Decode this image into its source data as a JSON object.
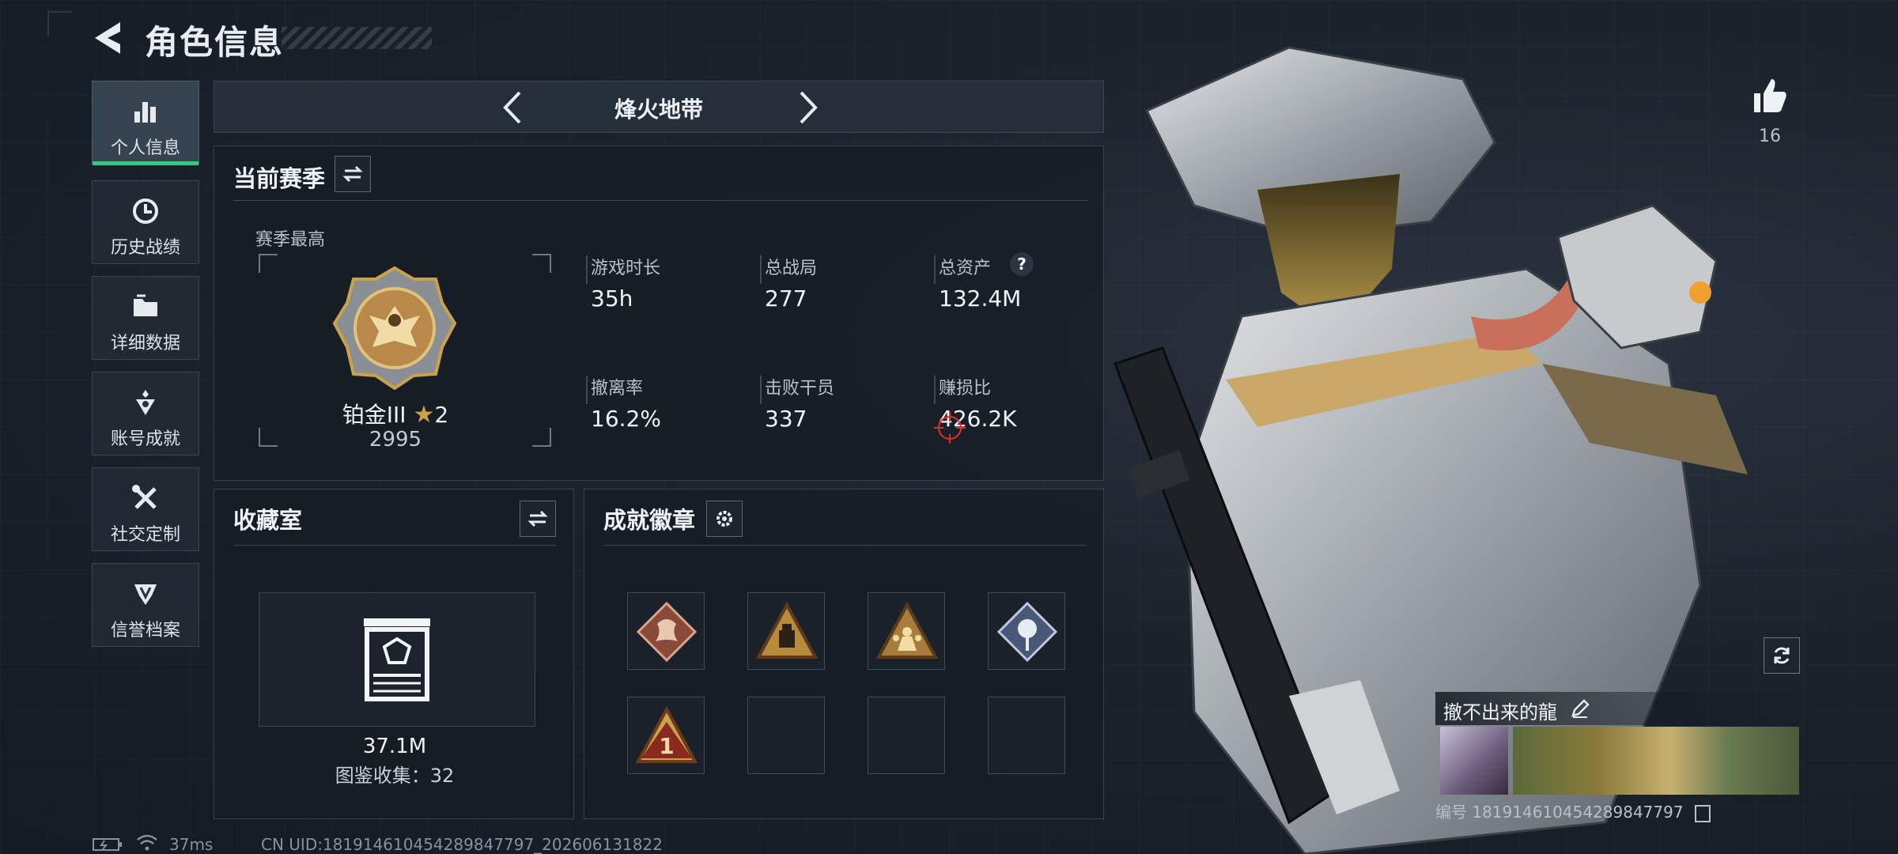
{
  "header": {
    "title": "角色信息",
    "back_icon": "back-arrow-icon"
  },
  "sidebar": {
    "items": [
      {
        "label": "个人信息",
        "icon": "bar-chart-icon",
        "active": true
      },
      {
        "label": "历史战绩",
        "icon": "history-clock-icon",
        "active": false
      },
      {
        "label": "详细数据",
        "icon": "folder-icon",
        "active": false
      },
      {
        "label": "账号成就",
        "icon": "achievement-icon",
        "active": false
      },
      {
        "label": "社交定制",
        "icon": "tools-icon",
        "active": false
      },
      {
        "label": "信誉档案",
        "icon": "reputation-icon",
        "active": false
      }
    ]
  },
  "mode": {
    "name": "烽火地带"
  },
  "season": {
    "title": "当前赛季",
    "best_label": "赛季最高",
    "rank": "铂金III",
    "stars": "2",
    "score": "2995",
    "stats": [
      {
        "label": "游戏时长",
        "value": "35h"
      },
      {
        "label": "总战局",
        "value": "277"
      },
      {
        "label": "总资产",
        "value": "132.4M"
      },
      {
        "label": "撤离率",
        "value": "16.2%"
      },
      {
        "label": "击败干员",
        "value": "337"
      },
      {
        "label": "赚损比",
        "value": "426.2K"
      }
    ]
  },
  "collection": {
    "title": "收藏室",
    "value": "37.1M",
    "catalog_label": "图鉴收集：32"
  },
  "achievements": {
    "title": "成就徽章",
    "badges": [
      "dragon-badge-icon",
      "supply-badge-icon",
      "squad-badge-icon",
      "rose-badge-icon",
      "first-place-badge-icon",
      "",
      "",
      ""
    ]
  },
  "player": {
    "likes": "16",
    "name": "撤不出来的龍",
    "id_label": "编号 1819146104542898477​97"
  },
  "status": {
    "ping": "37ms",
    "uid": "CN UID:18191461045428984779​7_202606131822"
  },
  "colors": {
    "accent": "#3cc48a",
    "gold": "#c9a24a",
    "crosshair": "#e0312b"
  }
}
